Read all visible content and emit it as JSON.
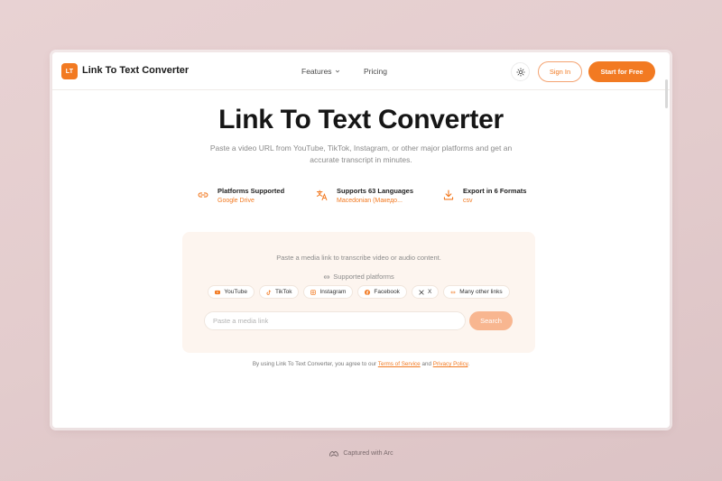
{
  "header": {
    "logo_text": "LT",
    "brand": "Link To Text Converter",
    "nav": {
      "features": "Features",
      "pricing": "Pricing"
    },
    "sign_in": "Sign In",
    "start": "Start for Free",
    "theme_icon": "sun-icon"
  },
  "hero": {
    "title": "Link To Text Converter",
    "subtitle": "Paste a video URL from YouTube, TikTok, Instagram, or other major platforms and get an accurate transcript in minutes."
  },
  "features": [
    {
      "icon": "link-icon",
      "title": "Platforms Supported",
      "value": "Google Drive"
    },
    {
      "icon": "translate-icon",
      "title": "Supports 63 Languages",
      "value": "Macedonian (Македо..."
    },
    {
      "icon": "download-icon",
      "title": "Export in 6 Formats",
      "value": "csv"
    }
  ],
  "card": {
    "instruction": "Paste a media link to transcribe video or audio content.",
    "supported_label": "Supported platforms",
    "platforms": [
      "YouTube",
      "TikTok",
      "Instagram",
      "Facebook",
      "X",
      "Many other links"
    ],
    "input_placeholder": "Paste a media link",
    "search_label": "Search"
  },
  "terms": {
    "prefix": "By using Link To Text Converter, you agree to our",
    "tos": "Terms of Service",
    "and": "and",
    "privacy": "Privacy Policy",
    "suffix": "."
  },
  "footer": {
    "captured": "Captured with Arc"
  },
  "colors": {
    "accent": "#f27a22",
    "accent_light": "#f8b690",
    "card_bg": "#fdf5ef"
  }
}
